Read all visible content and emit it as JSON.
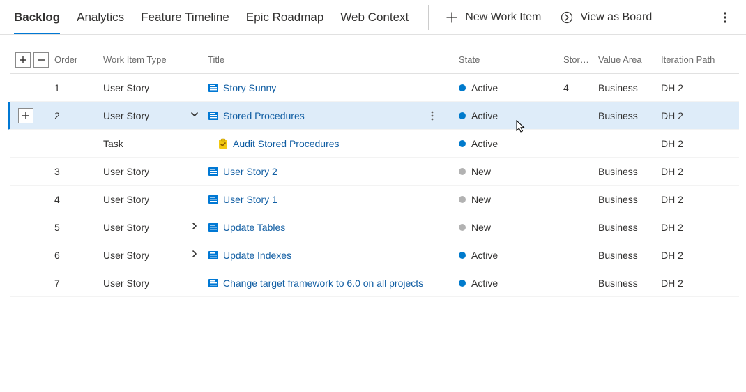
{
  "nav": {
    "tabs": [
      "Backlog",
      "Analytics",
      "Feature Timeline",
      "Epic Roadmap",
      "Web Context"
    ],
    "activeIndex": 0
  },
  "toolbar": {
    "new_item": "New Work Item",
    "view_as_board": "View as Board"
  },
  "columns": {
    "order": "Order",
    "type": "Work Item Type",
    "title": "Title",
    "state": "State",
    "story": "Story…",
    "value_area": "Value Area",
    "iteration": "Iteration Path"
  },
  "colors": {
    "active": "#007acc",
    "new": "#b2b2b2",
    "user_story": "#0078d4",
    "task_bg": "#f2c811",
    "task_check": "#8a5a00"
  },
  "rows": [
    {
      "order": "1",
      "type": "User Story",
      "expand": "",
      "indent": 0,
      "icon": "user-story",
      "title": "Story Sunny",
      "state": "Active",
      "stateColorKey": "active",
      "story": "4",
      "valueArea": "Business",
      "iteration": "DH 2",
      "selected": false
    },
    {
      "order": "2",
      "type": "User Story",
      "expand": "down",
      "indent": 0,
      "icon": "user-story",
      "title": "Stored Procedures",
      "state": "Active",
      "stateColorKey": "active",
      "story": "",
      "valueArea": "Business",
      "iteration": "DH 2",
      "selected": true
    },
    {
      "order": "",
      "type": "Task",
      "expand": "",
      "indent": 1,
      "icon": "task",
      "title": "Audit Stored Procedures",
      "state": "Active",
      "stateColorKey": "active",
      "story": "",
      "valueArea": "",
      "iteration": "DH 2",
      "selected": false
    },
    {
      "order": "3",
      "type": "User Story",
      "expand": "",
      "indent": 0,
      "icon": "user-story",
      "title": "User Story 2",
      "state": "New",
      "stateColorKey": "new",
      "story": "",
      "valueArea": "Business",
      "iteration": "DH 2",
      "selected": false
    },
    {
      "order": "4",
      "type": "User Story",
      "expand": "",
      "indent": 0,
      "icon": "user-story",
      "title": "User Story 1",
      "state": "New",
      "stateColorKey": "new",
      "story": "",
      "valueArea": "Business",
      "iteration": "DH 2",
      "selected": false
    },
    {
      "order": "5",
      "type": "User Story",
      "expand": "right",
      "indent": 0,
      "icon": "user-story",
      "title": "Update Tables",
      "state": "New",
      "stateColorKey": "new",
      "story": "",
      "valueArea": "Business",
      "iteration": "DH 2",
      "selected": false
    },
    {
      "order": "6",
      "type": "User Story",
      "expand": "right",
      "indent": 0,
      "icon": "user-story",
      "title": "Update Indexes",
      "state": "Active",
      "stateColorKey": "active",
      "story": "",
      "valueArea": "Business",
      "iteration": "DH 2",
      "selected": false
    },
    {
      "order": "7",
      "type": "User Story",
      "expand": "",
      "indent": 0,
      "icon": "user-story",
      "title": "Change target framework to 6.0 on all projects",
      "state": "Active",
      "stateColorKey": "active",
      "story": "",
      "valueArea": "Business",
      "iteration": "DH 2",
      "selected": false
    }
  ]
}
